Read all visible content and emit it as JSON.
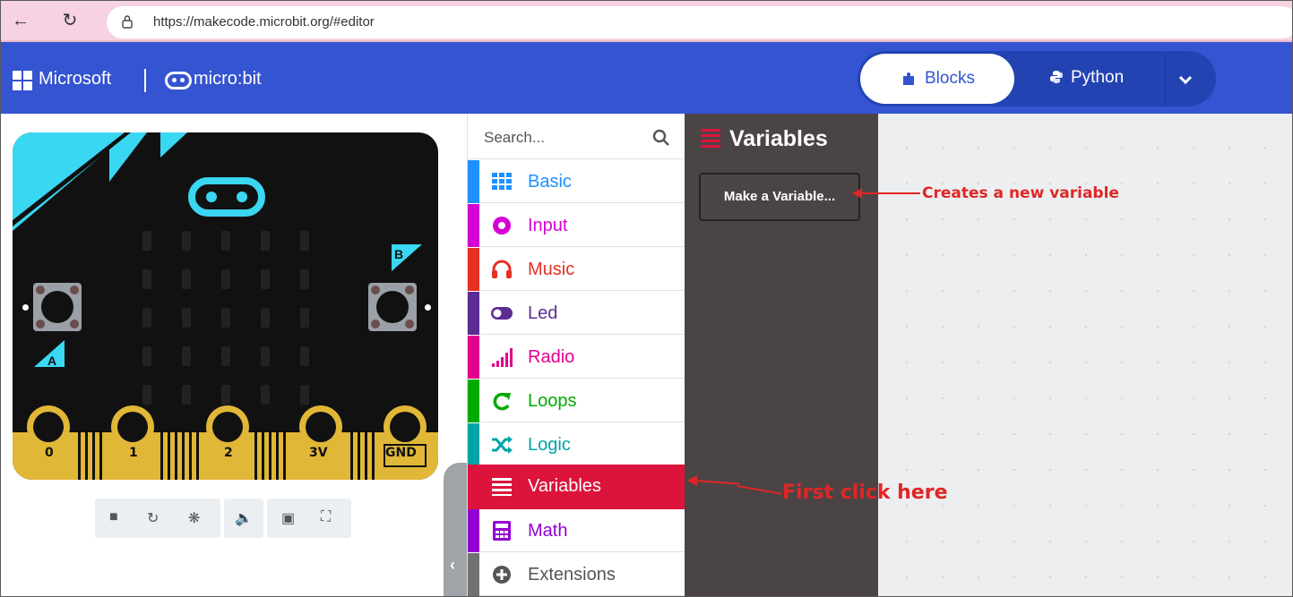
{
  "browser": {
    "url": "https://makecode.microbit.org/#editor",
    "back_icon": "arrow-left-icon",
    "reload_icon": "reload-icon",
    "lock_icon": "lock-icon"
  },
  "header": {
    "brand": "Microsoft",
    "product": "micro:bit",
    "modes": [
      {
        "label": "Blocks",
        "icon": "puzzle-icon",
        "active": true
      },
      {
        "label": "Python",
        "icon": "python-icon",
        "active": false
      }
    ],
    "dropdown_icon": "chevron-down-icon",
    "colors": {
      "header_bg": "#3454d1",
      "toggle_bg": "#2343b3"
    }
  },
  "simulator": {
    "pins": [
      "0",
      "1",
      "2",
      "3V",
      "GND"
    ],
    "button_a": "A",
    "button_b": "B",
    "toolbar_icons": [
      "stop-icon",
      "restart-icon",
      "debug-icon",
      "mute-icon",
      "screenshot-icon",
      "fullscreen-icon"
    ]
  },
  "toolbox": {
    "search_placeholder": "Search...",
    "categories": [
      {
        "label": "Basic",
        "color": "#1e90ff",
        "icon": "grid-icon"
      },
      {
        "label": "Input",
        "color": "#d400d4",
        "icon": "input-circle-icon"
      },
      {
        "label": "Music",
        "color": "#e63022",
        "icon": "headphones-icon"
      },
      {
        "label": "Led",
        "color": "#5c2d91",
        "icon": "toggle-icon"
      },
      {
        "label": "Radio",
        "color": "#e3008c",
        "icon": "signal-bars-icon"
      },
      {
        "label": "Loops",
        "color": "#00aa00",
        "icon": "loop-arrow-icon"
      },
      {
        "label": "Logic",
        "color": "#00a4a6",
        "icon": "shuffle-icon"
      },
      {
        "label": "Variables",
        "color": "#dc143c",
        "icon": "list-lines-icon",
        "selected": true
      },
      {
        "label": "Math",
        "color": "#9400d3",
        "icon": "calculator-icon"
      },
      {
        "label": "Extensions",
        "color": "#717171",
        "icon": "plus-circle-icon"
      }
    ]
  },
  "flyout": {
    "title": "Variables",
    "make_variable_label": "Make a Variable..."
  },
  "annotations": {
    "make_variable_note": "Creates a new variable",
    "variables_note": "First click here",
    "color": "#e02626"
  }
}
